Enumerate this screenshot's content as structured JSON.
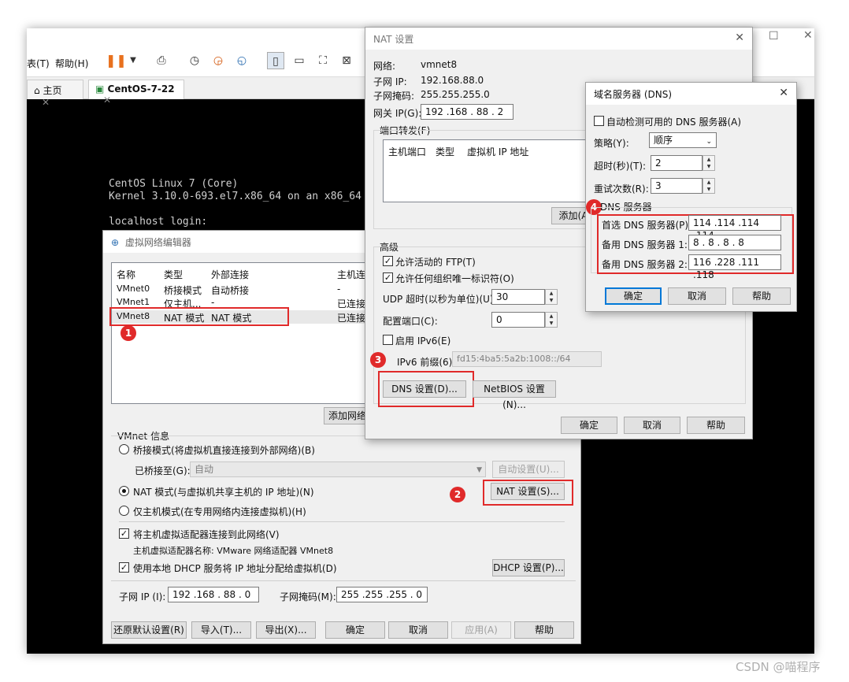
{
  "vmware": {
    "menu_partial": "表(T)",
    "menu_help": "帮助(H)",
    "tabs": [
      {
        "label": "主页"
      },
      {
        "label": "CentOS-7-22"
      }
    ],
    "console": {
      "line1": "CentOS Linux 7 (Core)",
      "line2": "Kernel 3.10.0-693.el7.x86_64 on an x86_64",
      "line3": "localhost login:"
    }
  },
  "vne": {
    "title": "虚拟网络编辑器",
    "columns": [
      "名称",
      "类型",
      "外部连接",
      "主机连"
    ],
    "rows": [
      {
        "name": "VMnet0",
        "type": "桥接模式",
        "external": "自动桥接",
        "host": "-"
      },
      {
        "name": "VMnet1",
        "type": "仅主机...",
        "external": "-",
        "host": "已连接"
      },
      {
        "name": "VMnet8",
        "type": "NAT 模式",
        "external": "NAT 模式",
        "host": "已连接"
      }
    ],
    "add_network_button": "添加网络",
    "info_label": "VMnet 信息",
    "bridge_radio": "桥接模式(将虚拟机直接连接到外部网络)(B)",
    "bridge_to_label": "已桥接至(G):",
    "bridge_to_value": "自动",
    "auto_settings_button": "自动设置(U)...",
    "nat_radio": "NAT 模式(与虚拟机共享主机的 IP 地址)(N)",
    "nat_settings_button": "NAT 设置(S)...",
    "hostonly_radio": "仅主机模式(在专用网络内连接虚拟机)(H)",
    "connect_adapter_check": "将主机虚拟适配器连接到此网络(V)",
    "adapter_name_text": "主机虚拟适配器名称: VMware 网络适配器 VMnet8",
    "dhcp_check": "使用本地 DHCP 服务将 IP 地址分配给虚拟机(D)",
    "dhcp_settings_button": "DHCP 设置(P)...",
    "subnet_ip_label": "子网 IP (I):",
    "subnet_ip_value": "192 .168 . 88 .  0",
    "subnet_mask_label": "子网掩码(M):",
    "subnet_mask_value": "255 .255 .255 .  0",
    "restore_button": "还原默认设置(R)",
    "import_button": "导入(T)...",
    "export_button": "导出(X)...",
    "ok_button": "确定",
    "cancel_button": "取消",
    "apply_button": "应用(A)",
    "help_button": "帮助"
  },
  "nat": {
    "title": "NAT 设置",
    "network_label": "网络:",
    "network_value": "vmnet8",
    "subnet_ip_label": "子网 IP:",
    "subnet_ip_value": "192.168.88.0",
    "subnet_mask_label": "子网掩码:",
    "subnet_mask_value": "255.255.255.0",
    "gateway_label": "网关 IP(G):",
    "gateway_value": "192 .168 . 88 .  2",
    "port_forward_label": "端口转发(F)",
    "pf_columns": [
      "主机端口",
      "类型",
      "虚拟机 IP 地址"
    ],
    "add_button": "添加(A",
    "advanced_label": "高级",
    "allow_ftp": "允许活动的 FTP(T)",
    "allow_oui": "允许任何组织唯一标识符(O)",
    "udp_timeout_label": "UDP 超时(以秒为单位)(U):",
    "udp_timeout_value": "30",
    "config_port_label": "配置端口(C):",
    "config_port_value": "0",
    "enable_ipv6": "启用 IPv6(E)",
    "ipv6_prefix_label": "IPv6 前缀(6):",
    "ipv6_prefix_value": "fd15:4ba5:5a2b:1008::/64",
    "dns_settings_button": "DNS 设置(D)...",
    "netbios_button": "NetBIOS 设置(N)...",
    "ok_button": "确定",
    "cancel_button": "取消",
    "help_button": "帮助"
  },
  "dns": {
    "title": "域名服务器 (DNS)",
    "auto_detect": "自动检测可用的 DNS 服务器(A)",
    "policy_label": "策略(Y):",
    "policy_value": "顺序",
    "timeout_label": "超时(秒)(T):",
    "timeout_value": "2",
    "retries_label": "重试次数(R):",
    "retries_value": "3",
    "servers_label": "DNS 服务器",
    "preferred_label": "首选 DNS 服务器(P):",
    "preferred_value": "114 .114 .114 .114",
    "alternate1_label": "备用 DNS 服务器 1:",
    "alternate1_value": "8  .  8  .  8  .  8",
    "alternate2_label": "备用 DNS 服务器 2:",
    "alternate2_value": "116 .228 .111 .118",
    "ok_button": "确定",
    "cancel_button": "取消",
    "help_button": "帮助"
  },
  "annotations": [
    "1",
    "2",
    "3",
    "4"
  ],
  "watermark": "CSDN @喵程序"
}
